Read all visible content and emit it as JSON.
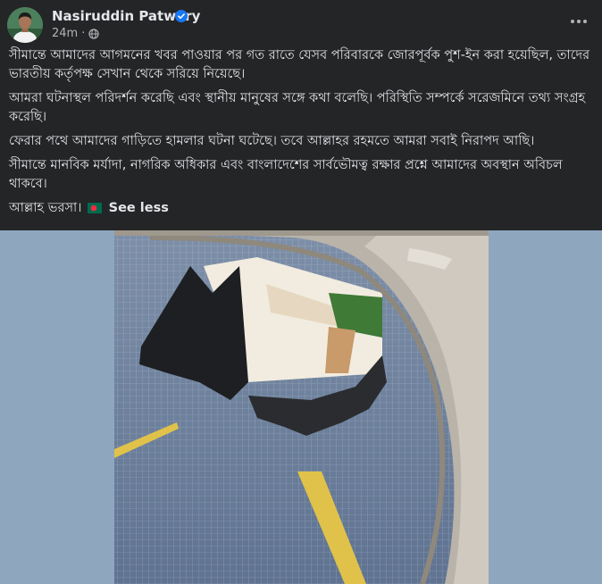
{
  "post": {
    "author": "Nasiruddin Patwary",
    "timestamp": "24m",
    "separator": "·",
    "paragraphs": [
      "সীমান্তে আমাদের আগমনের খবর পাওয়ার পর গত রাতে যেসব পরিবারকে জোরপূর্বক পুশ-ইন করা হয়েছিল, তাদের ভারতীয় কর্তৃপক্ষ সেখান থেকে সরিয়ে নিয়েছে।",
      "আমরা ঘটনাস্থল পরিদর্শন করেছি এবং স্থানীয় মানুষের সঙ্গে কথা বলেছি। পরিস্থিতি সম্পর্কে সরেজমিনে তথ্য সংগ্রহ করেছি।",
      "ফেরার পথে আমাদের গাড়িতে হামলার ঘটনা ঘটেছে। তবে আল্লাহর রহমতে আমরা সবাই নিরাপদ আছি।",
      "সীমান্তে মানবিক মর্যাদা, নাগরিক অধিকার এবং বাংলাদেশের সার্বভৌমত্ব রক্ষার প্রশ্নে আমাদের অবস্থান অবিচল থাকবে।"
    ],
    "closing": "আল্লাহ ভরসা।",
    "see_less": "See less"
  },
  "icons": {
    "verified": "verified-badge-icon",
    "audience": "globe-icon",
    "more": "more-options-icon",
    "flag": "bangladesh-flag-icon"
  },
  "colors": {
    "background": "#242526",
    "text": "#e4e6eb",
    "secondary_text": "#b0b3b8",
    "verified_blue": "#1877f2",
    "media_backdrop": "#8ea7bf"
  }
}
